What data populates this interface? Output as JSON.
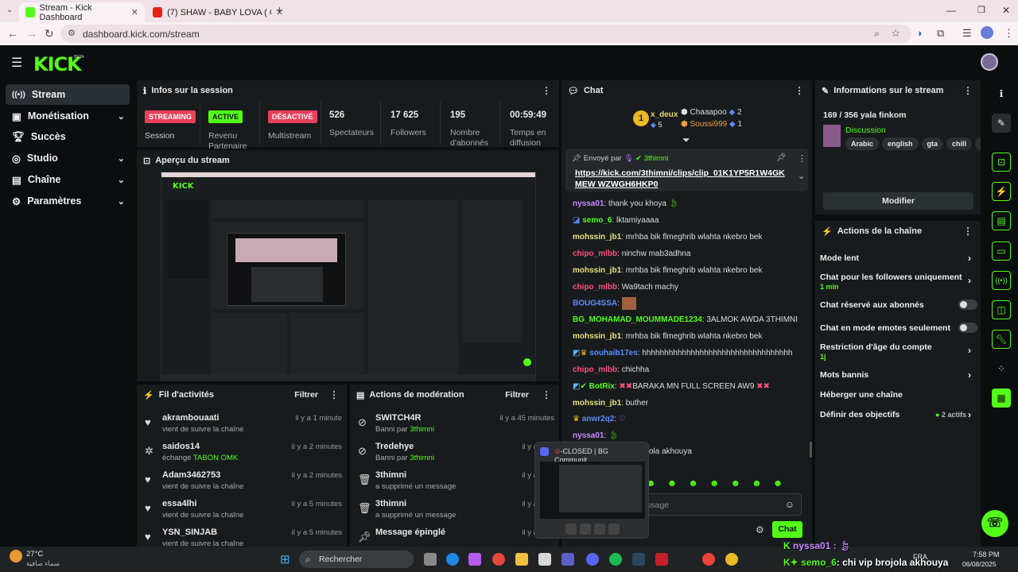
{
  "browser": {
    "tabs": [
      {
        "title": "Stream - Kick Dashboard",
        "active": true
      },
      {
        "title": "(7) SHAW - BABY LOVA ( OFFICI",
        "active": false
      }
    ],
    "url": "dashboard.kick.com/stream"
  },
  "header": {
    "logo": "KICK",
    "beta": "BETA"
  },
  "sidebar": {
    "items": [
      {
        "label": "Stream",
        "icon": "stream-icon",
        "selected": true
      },
      {
        "label": "Monétisation",
        "icon": "monetization-icon",
        "chevron": true
      },
      {
        "label": "Succès",
        "icon": "trophy-icon"
      },
      {
        "label": "Studio",
        "icon": "studio-icon",
        "chevron": true
      },
      {
        "label": "Chaîne",
        "icon": "channel-icon",
        "chevron": true
      },
      {
        "label": "Paramètres",
        "icon": "gear-icon",
        "chevron": true
      }
    ]
  },
  "session": {
    "title": "Infos sur la session",
    "stats": [
      {
        "badge": "STREAMING",
        "badge_color": "#e8405b",
        "label": "Session"
      },
      {
        "badge": "ACTIVE",
        "badge_color": "#53fc18",
        "label": "Revenu Partenaire"
      },
      {
        "badge": "DÉSACTIVÉ",
        "badge_color": "#e8405b",
        "label": "Multistream"
      },
      {
        "value": "526",
        "label": "Spectateurs"
      },
      {
        "value": "17 625",
        "label": "Followers"
      },
      {
        "value": "195",
        "label": "Nombre d'abonnés"
      },
      {
        "value": "00:59:49",
        "label": "Temps en diffusion"
      }
    ]
  },
  "preview": {
    "title": "Aperçu du stream"
  },
  "activity": {
    "title": "Fil d'activités",
    "filter": "Filtrer",
    "items": [
      {
        "name": "akrambouaati",
        "sub": "vient de suivre la chaîne",
        "time": "il y a 1 minute",
        "icon": "heart-icon"
      },
      {
        "name": "saidos14",
        "sub_prefix": "échangé ",
        "sub_highlight": "TABON OMK",
        "time": "il y a 2 minutes",
        "icon": "redeem-icon"
      },
      {
        "name": "Adam3462753",
        "sub": "vient de suivre la chaîne",
        "time": "il y a 2 minutes",
        "icon": "heart-icon"
      },
      {
        "name": "essa4lhi",
        "sub": "vient de suivre la chaîne",
        "time": "il y a 5 minutes",
        "icon": "heart-icon"
      },
      {
        "name": "YSN_SINJAB",
        "sub": "vient de suivre la chaîne",
        "time": "il y a 5 minutes",
        "icon": "heart-icon"
      }
    ]
  },
  "moderation": {
    "title": "Actions de modération",
    "filter": "Filtrer",
    "items": [
      {
        "name": "SWITCH4R",
        "sub_prefix": "Banni par ",
        "sub_highlight": "3thimni",
        "time": "il y a 45 minutes",
        "icon": "ban-icon"
      },
      {
        "name": "Tredehye",
        "sub_prefix": "Banni par ",
        "sub_highlight": "3thimni",
        "time": "il y a 13 h",
        "icon": "ban-icon"
      },
      {
        "name": "3thimni",
        "sub": "a supprimé un message",
        "time": "il y a 14 h",
        "icon": "trash-icon"
      },
      {
        "name": "3thimni",
        "sub": "a supprimé un message",
        "time": "il y a 14 h",
        "icon": "trash-icon"
      },
      {
        "name": "Message épinglé",
        "sub": "",
        "time": "il y a 14 h",
        "icon": "pin-icon"
      }
    ]
  },
  "chat": {
    "title": "Chat",
    "leaderboard": [
      {
        "rank": "1",
        "name": "x_deux",
        "value": "5"
      },
      {
        "name": "Chaaapoo",
        "value": "2"
      },
      {
        "name": "Soussi999",
        "value": "1"
      }
    ],
    "pinned": {
      "sent_by_label": "Envoyé par",
      "sent_by": "3thimni",
      "link": "https://kick.com/3thimni/clips/clip_01K1YP5R1W4GKMEW WZWGH6HKP0"
    },
    "messages": [
      {
        "user": "nyssa01",
        "color": "#c58cff",
        "text": "thank you khoya"
      },
      {
        "user": "semo_6",
        "color": "#53fc18",
        "text": "lktamiyaaaa"
      },
      {
        "user": "mohssin_jb1",
        "color": "#e8e07a",
        "text": "mrhba bik flmeghrib wlahta nkebro bek"
      },
      {
        "user": "chipo_mlbb",
        "color": "#ff4f7e",
        "text": "ninchw mab3adhna"
      },
      {
        "user": "mohssin_jb1",
        "color": "#e8e07a",
        "text": "mrhba bik flmeghrib wlahta nkebro bek"
      },
      {
        "user": "chipo_mlbb",
        "color": "#ff4f7e",
        "text": "Wa9tach machy"
      },
      {
        "user": "BOUG4SSA",
        "color": "#5b8cff",
        "text": ""
      },
      {
        "user": "BG_MOHAMAD_MOUMMADE1234",
        "color": "#53fc18",
        "text": "3ALMOK AWDA 3THIMNI"
      },
      {
        "user": "mohssin_jb1",
        "color": "#e8e07a",
        "text": "mrhba bik flmeghrib wlahta nkebro bek"
      },
      {
        "user": "souhaib17es",
        "color": "#5b8cff",
        "text": "hhhhhhhhhhhhhhhhhhhhhhhhhhhhhhhhhh"
      },
      {
        "user": "chipo_mlbb",
        "color": "#ff4f7e",
        "text": "chichha"
      },
      {
        "user": "BotRix",
        "color": "#53fc18",
        "text": "BARAKA MN FULL SCREEN AW9"
      },
      {
        "user": "mohssin_jb1",
        "color": "#e8e07a",
        "text": "buther"
      },
      {
        "user": "anwr2q2",
        "color": "#5b8cff",
        "text": ""
      },
      {
        "user": "nyssa01",
        "color": "#c58cff",
        "text": ""
      },
      {
        "user": "",
        "color": "#ddd",
        "text": "ola akhouya"
      }
    ],
    "input_placeholder": "ssage",
    "send_label": "Chat"
  },
  "stream_info": {
    "title": "Informations sur le stream",
    "stream_title": "169 / 356 yala finkom",
    "category": "Discussion",
    "tags": [
      "Arabic",
      "english",
      "gta",
      "chill",
      "Ro"
    ],
    "edit_label": "Modifier"
  },
  "channel_actions": {
    "title": "Actions de la chaîne",
    "items": [
      {
        "label": "Mode lent",
        "type": "arrow"
      },
      {
        "label": "Chat pour les followers uniquement",
        "sub": "1 min",
        "type": "arrow"
      },
      {
        "label": "Chat réservé aux abonnés",
        "type": "toggle"
      },
      {
        "label": "Chat en mode emotes seulement",
        "type": "toggle"
      },
      {
        "label": "Restriction d'âge du compte",
        "sub": "1j",
        "type": "arrow"
      },
      {
        "label": "Mots bannis",
        "type": "arrow"
      },
      {
        "label": "Héberger une chaîne",
        "type": "none"
      },
      {
        "label": "Définir des objectifs",
        "extra": "2 actifs",
        "type": "arrow"
      }
    ]
  },
  "discord_popup": {
    "title": "-CLOSED | BG Communit..."
  },
  "overlay_chat": [
    {
      "user": "nyssa01 :",
      "text": ""
    },
    {
      "user": "semo_6",
      "text": ": chi vip brojola akhouya"
    }
  ],
  "taskbar": {
    "weather_temp": "27°C",
    "weather_desc": "سماء صافية",
    "search_placeholder": "Rechercher",
    "lang": "FRA",
    "time": "7:58 PM",
    "date": "06/08/2025"
  }
}
